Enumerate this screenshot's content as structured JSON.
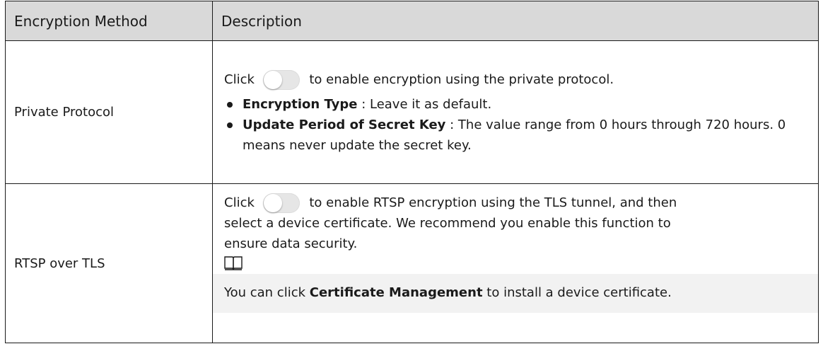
{
  "header": {
    "method": "Encryption Method",
    "description": "Description"
  },
  "rows": [
    {
      "method": "Private Protocol",
      "click_prefix": "Click",
      "click_suffix": "to enable encryption using the private protocol.",
      "bullets": [
        {
          "label": "Encryption Type",
          "text": " : Leave it as default."
        },
        {
          "label": "Update Period of Secret Key",
          "text": " : The value range from 0 hours through 720 hours. 0 means never update the secret key."
        }
      ]
    },
    {
      "method": "RTSP over TLS",
      "click_prefix": "Click",
      "click_suffix": "to enable RTSP encryption using the TLS tunnel, and then",
      "lines": [
        "select a device certificate. We recommend you enable this function to",
        "ensure data security."
      ],
      "note": {
        "prefix": "You can click ",
        "bold": "Certificate Management",
        "suffix": "  to install a device certificate."
      }
    }
  ],
  "icons": {
    "toggle": "toggle-switch-off-icon",
    "note": "book-icon"
  }
}
